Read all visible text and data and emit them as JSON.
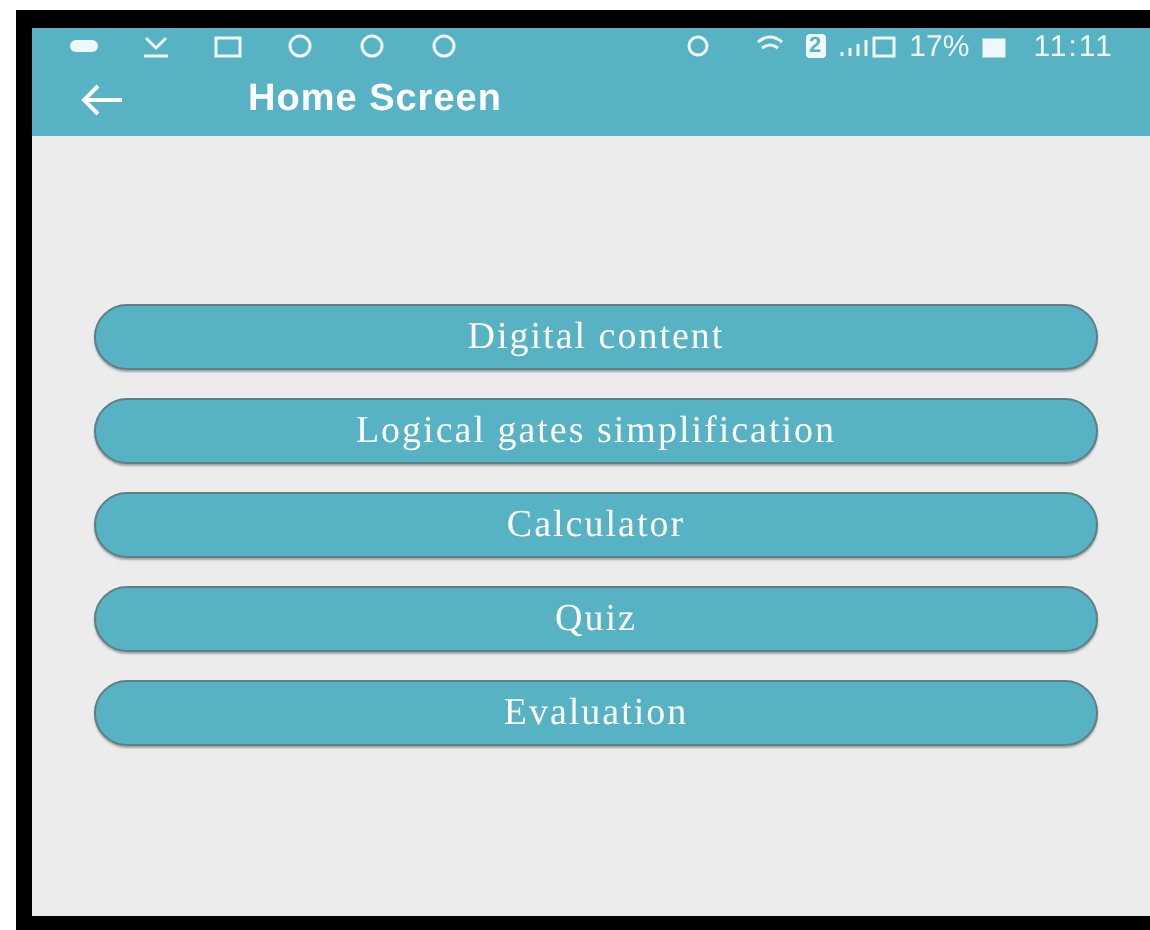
{
  "status_bar": {
    "sim_badge": "2",
    "battery": "17%",
    "time": "11:11"
  },
  "app_bar": {
    "title": "Home Screen"
  },
  "menu": [
    {
      "label": "Digital content"
    },
    {
      "label": "Logical gates simplification"
    },
    {
      "label": "Calculator"
    },
    {
      "label": "Quiz"
    },
    {
      "label": "Evaluation"
    }
  ]
}
